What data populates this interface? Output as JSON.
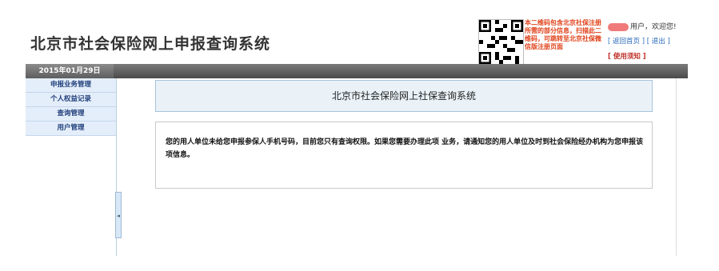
{
  "header": {
    "title": "北京市社会保险网上申报查询系统",
    "qr_note": "本二维码包含北京社保注册所需的部分信息，扫描此二维码，可跳转至北京社保微信版注册页面",
    "user_greeting": "用户，欢迎您!",
    "links": {
      "home": "[ 返回首页 ]",
      "logout": "[ 退出 ]",
      "help": "[ 使用须知 ]"
    }
  },
  "topbar": {
    "date": "2015年01月29日"
  },
  "sidebar": {
    "items": [
      {
        "label": "申报业务管理"
      },
      {
        "label": "个人权益记录"
      },
      {
        "label": "查询管理"
      },
      {
        "label": "用户管理"
      }
    ],
    "collapse_glyph": "◂"
  },
  "main": {
    "header_title": "北京市社会保险网上社保查询系统",
    "message": "您的用人单位未给您申报参保人手机号码，目前您只有查询权限。如果您需要办理此项 业务，请通知您的用人单位及时到社会保险经办机构为您申报该项信息。"
  },
  "colors": {
    "accent": "#1f3e7a",
    "warning": "#e0421a",
    "link": "#2a6ab8"
  }
}
